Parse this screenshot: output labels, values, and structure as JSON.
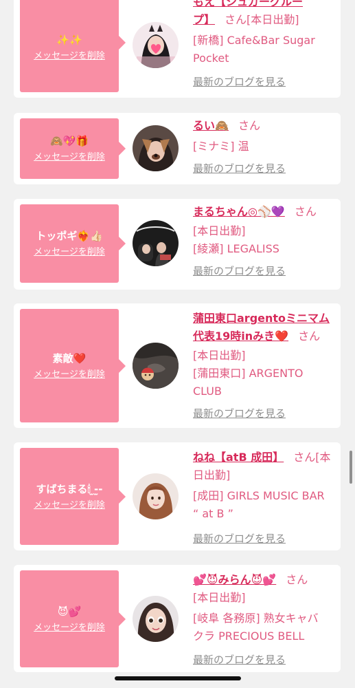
{
  "colors": {
    "accent": "#d72a5a",
    "bubble": "#f98ea4",
    "text_pink": "#e05a80",
    "blog_gray": "#8e8e8e"
  },
  "cards": [
    {
      "message": "✨✨",
      "delete_label": "メッセージを削除",
      "name_line1": "もえ【シュガーグルー",
      "name_line2": "プ】",
      "san": "さん",
      "after_san": "[本日出勤]",
      "lines": [
        "[新橋] Cafe&Bar Sugar",
        "Pocket"
      ],
      "blog_label": "最新のブログを見る"
    },
    {
      "message": "🙈💖🎁",
      "delete_label": "メッセージを削除",
      "name": "るい🙈",
      "san": "さん",
      "lines": [
        "[ミナミ] 温"
      ],
      "blog_label": "最新のブログを見る"
    },
    {
      "message": "トッポギ❤️‍🔥👍🏻",
      "delete_label": "メッセージを削除",
      "name": "まるちゃん◎⚾️💜",
      "san": "さん",
      "lines": [
        "[本日出勤]",
        "[綾瀬] LEGALISS"
      ],
      "blog_label": "最新のブログを見る"
    },
    {
      "message": "素敵❤️",
      "delete_label": "メッセージを削除",
      "name_line1": "蒲田東口argentoミニマム",
      "name_line2": "代表19時inみき❤️",
      "san": "さん",
      "lines": [
        "[本日出勤]",
        "[蒲田東口] ARGENTO",
        "CLUB"
      ],
      "blog_label": "最新のブログを見る"
    },
    {
      "message": "すばちまる🕯 ̫-̫-",
      "delete_label": "メッセージを削除",
      "name": "ねね【atB 成田】",
      "san": "さん[本",
      "lines": [
        "日出勤]",
        "[成田] GIRLS MUSIC BAR",
        "“ at B ”"
      ],
      "blog_label": "最新のブログを見る"
    },
    {
      "message": "😈💕",
      "delete_label": "メッセージを削除",
      "name": "💕😈みらん😈💕",
      "san": "さん",
      "lines": [
        "[本日出勤]",
        "[岐阜 各務原] 熟女キャバ",
        "クラ PRECIOUS BELL"
      ],
      "blog_label": "最新のブログを見る"
    }
  ]
}
